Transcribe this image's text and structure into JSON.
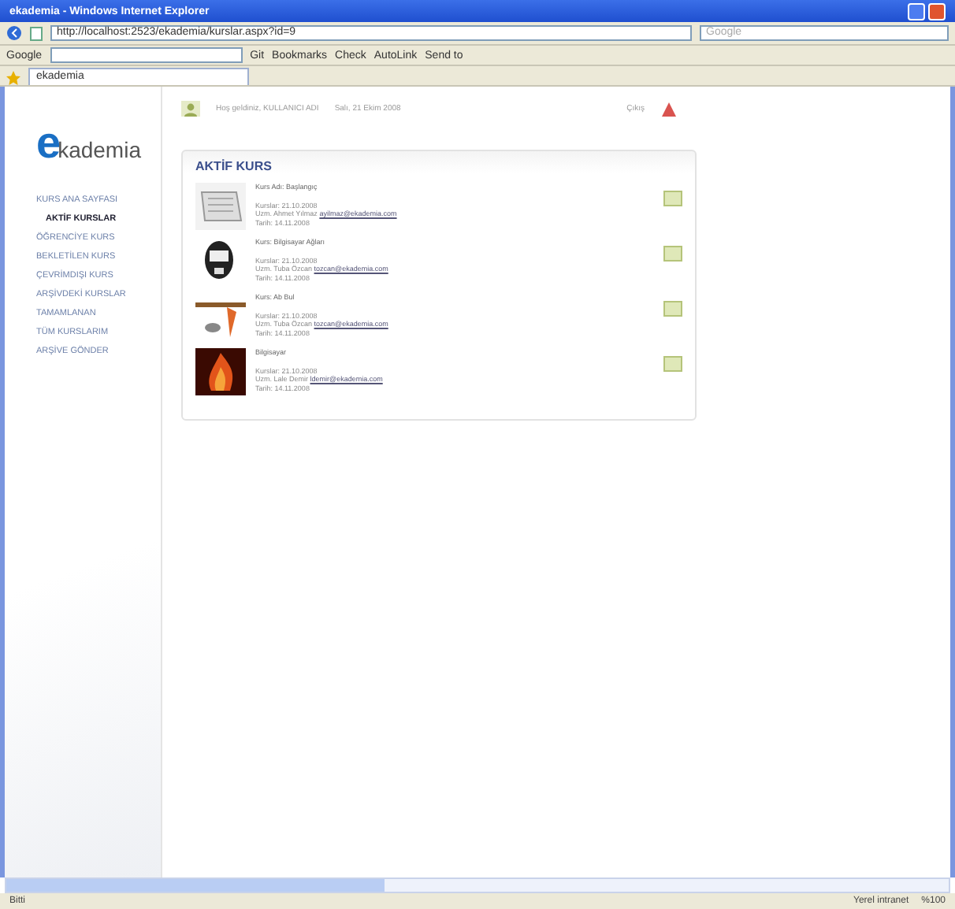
{
  "window": {
    "title": "ekademia - Windows Internet Explorer"
  },
  "address_bar": {
    "url": "http://localhost:2523/ekademia/kurslar.aspx?id=9",
    "search_placeholder": "Google"
  },
  "google_toolbar": {
    "label": "Google",
    "items": [
      "Git",
      "Bookmarks",
      "Check",
      "AutoLink",
      "Send to"
    ]
  },
  "tabs": [
    {
      "label": "ekademia",
      "selected": true
    }
  ],
  "header": {
    "logo_initial": "e",
    "logo_text": "kademia",
    "welcome": "Hoş geldiniz, KULLANICI ADI",
    "date": "Salı, 21 Ekim 2008",
    "logout": "Çıkış"
  },
  "sidebar": {
    "items": [
      {
        "label": "KURS ANA SAYFASI",
        "selected": false,
        "children": [
          {
            "label": "AKTİF KURSLAR",
            "selected": true
          }
        ]
      },
      {
        "label": "ÖĞRENCİYE KURS",
        "selected": false
      },
      {
        "label": "BEKLETİLEN KURS",
        "selected": false
      },
      {
        "label": "ÇEVRİMDIŞI KURS",
        "selected": false
      },
      {
        "label": "ARŞİVDEKİ KURSLAR",
        "selected": false
      },
      {
        "label": "TAMAMLANAN",
        "selected": false
      },
      {
        "label": "TÜM KURSLARIM",
        "selected": false
      },
      {
        "label": "ARŞİVE GÖNDER",
        "selected": false
      }
    ]
  },
  "panel": {
    "title": "AKTİF KURS",
    "courses": [
      {
        "title": "Kurs Adı: Başlangıç",
        "start": "Kurslar: 21.10.2008",
        "teacher": "Uzm. Ahmet Yılmaz",
        "email": "ayilmaz@ekademia.com",
        "end": "Tarih: 14.11.2008",
        "kind": "paper"
      },
      {
        "title": "Kurs: Bilgisayar Ağları",
        "start": "Kurslar: 21.10.2008",
        "teacher": "Uzm. Tuba Özcan",
        "email": "tozcan@ekademia.com",
        "end": "Tarih: 14.11.2008",
        "kind": "mask"
      },
      {
        "title": "Kurs: Ab Bul",
        "start": "Kurslar: 21.10.2008",
        "teacher": "Uzm. Tuba Özcan",
        "email": "tozcan@ekademia.com",
        "end": "Tarih: 14.11.2008",
        "kind": "tools"
      },
      {
        "title": "Bilgisayar",
        "start": "Kurslar: 21.10.2008",
        "teacher": "Uzm. Lale Demir",
        "email": "ldemir@ekademia.com",
        "end": "Tarih: 14.11.2008",
        "kind": "fire"
      }
    ]
  },
  "status_bar": {
    "text": "Bitti",
    "zone": "Yerel intranet",
    "zoom": "%100"
  }
}
